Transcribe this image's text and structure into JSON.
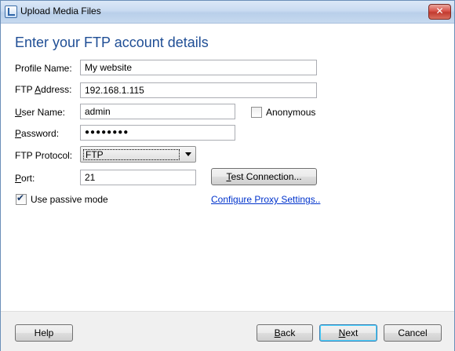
{
  "window": {
    "title": "Upload Media Files",
    "close_glyph": "✕"
  },
  "heading": "Enter your FTP account details",
  "form": {
    "profile_name": {
      "label": "Profile Name:",
      "value": "My website"
    },
    "ftp_address": {
      "label_pre": "FTP ",
      "label_access": "A",
      "label_post": "ddress:",
      "value": "192.168.1.115"
    },
    "user_name": {
      "label_pre": "",
      "label_access": "U",
      "label_post": "ser Name:",
      "value": "admin"
    },
    "anonymous": {
      "label": "Anonymous",
      "checked": false
    },
    "password": {
      "label_pre": "",
      "label_access": "P",
      "label_post": "assword:",
      "value": "●●●●●●●●"
    },
    "ftp_protocol": {
      "label": "FTP Protocol:",
      "selected": "FTP"
    },
    "port": {
      "label_pre": "",
      "label_access": "P",
      "label_post": "ort:",
      "value": "21"
    },
    "test_connection": {
      "label_pre": "",
      "label_access": "T",
      "label_post": "est Connection..."
    },
    "passive_mode": {
      "label": "Use passive mode",
      "checked": true
    },
    "proxy_link": "Configure Proxy Settings.."
  },
  "footer": {
    "help": "Help",
    "back": {
      "label_pre": "",
      "label_access": "B",
      "label_post": "ack"
    },
    "next": {
      "label_pre": "",
      "label_access": "N",
      "label_post": "ext"
    },
    "cancel": "Cancel"
  },
  "colors": {
    "heading": "#1f4e95",
    "link": "#0033cc",
    "close_button": "#c13a2f"
  },
  "icons": {
    "app": "upload-app-icon",
    "close": "close-icon",
    "dropdown": "chevron-down-icon",
    "check": "checkmark-icon"
  }
}
